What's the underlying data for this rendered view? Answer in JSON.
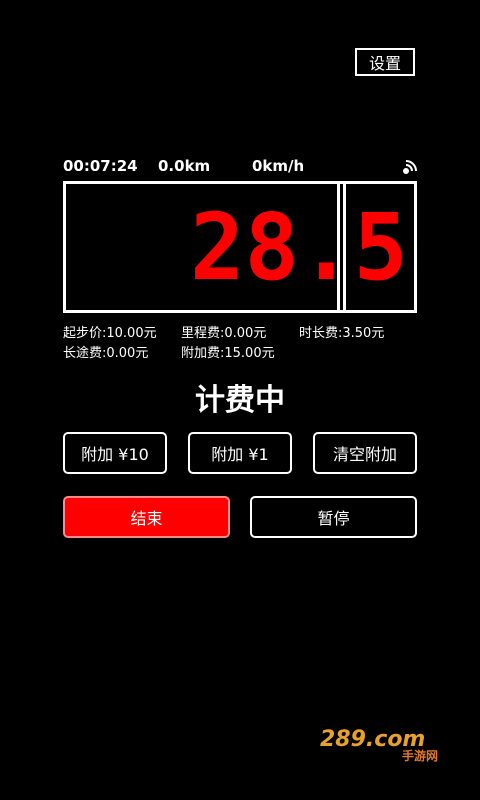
{
  "header": {
    "settings_label": "设置"
  },
  "status": {
    "time": "00:07:24",
    "distance": "0.0km",
    "speed": "0km/h",
    "signal_icon": "wifi-signal-icon"
  },
  "meter": {
    "display_value": "28.5",
    "digit_color": "#ff0000"
  },
  "fees": {
    "start_price": "起步价:10.00元",
    "mileage_fee": "里程费:0.00元",
    "duration_fee": "时长费:3.50元",
    "long_distance_fee": "长途费:0.00元",
    "surcharge_fee": "附加费:15.00元"
  },
  "state": {
    "title": "计费中"
  },
  "buttons": {
    "add10": "附加 ¥10",
    "add1": "附加 ¥1",
    "clear_add": "清空附加",
    "end": "结束",
    "pause": "暂停"
  },
  "watermark": {
    "brand": "289.com",
    "sub": "手游网"
  }
}
